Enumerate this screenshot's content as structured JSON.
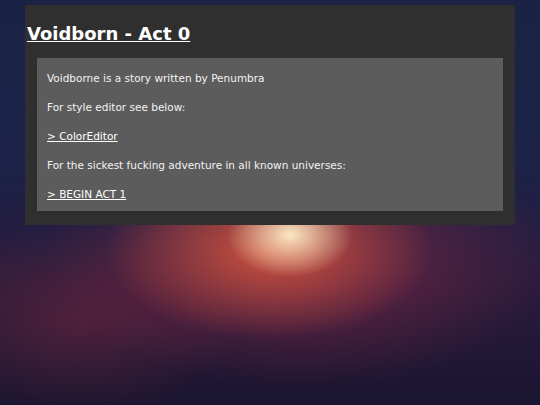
{
  "title": "Voidborn - Act 0",
  "lines": [
    {
      "text": "Voidborne is a story written by Penumbra",
      "kind": "text"
    },
    {
      "text": "For style editor see below:",
      "kind": "text"
    },
    {
      "text": "> ColorEditor",
      "kind": "link"
    },
    {
      "text": "For the sickest fucking adventure in all known universes:",
      "kind": "text"
    },
    {
      "text": "> BEGIN ACT 1",
      "kind": "link"
    }
  ]
}
